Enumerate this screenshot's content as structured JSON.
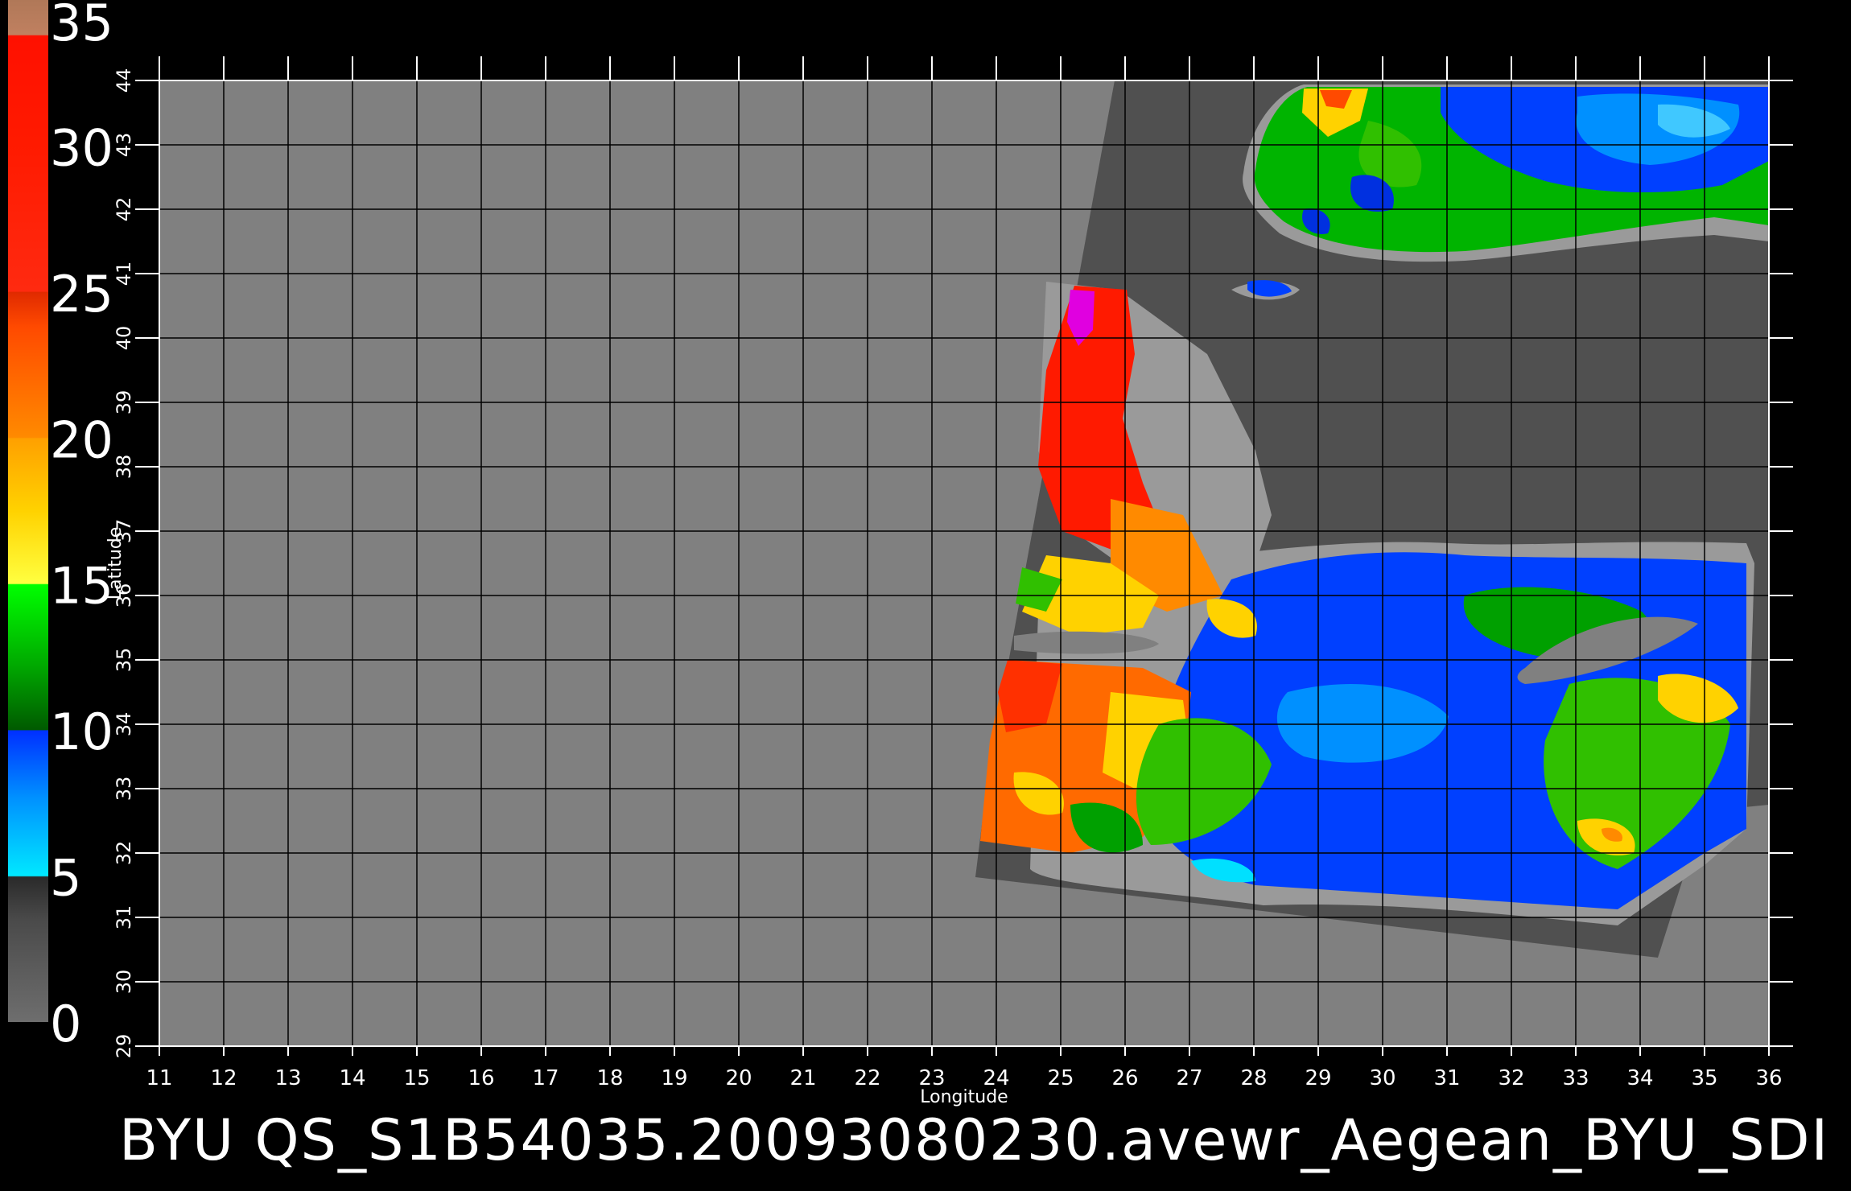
{
  "caption": "BYU QS_S1B54035.20093080230.avewr_Aegean_BYU_SDI",
  "axes": {
    "xlabel": "Longitude",
    "ylabel": "Latitude",
    "lon_range": [
      11,
      36
    ],
    "lat_range": [
      29,
      44
    ],
    "lon_ticks": [
      "11",
      "12",
      "13",
      "14",
      "15",
      "16",
      "17",
      "18",
      "19",
      "20",
      "21",
      "22",
      "23",
      "24",
      "25",
      "26",
      "27",
      "28",
      "29",
      "30",
      "31",
      "32",
      "33",
      "34",
      "35",
      "36"
    ],
    "lat_ticks": [
      "29",
      "30",
      "31",
      "32",
      "33",
      "34",
      "35",
      "36",
      "37",
      "38",
      "39",
      "40",
      "41",
      "42",
      "43",
      "44"
    ],
    "grid": true
  },
  "colorbar": {
    "labels": [
      "0",
      "5",
      "10",
      "15",
      "20",
      "25",
      "30",
      "35"
    ],
    "range": [
      0,
      35
    ]
  },
  "colors": {
    "background": "#000000",
    "no_data": "#808080",
    "swath_land": "#505050",
    "coast": "#9a9a9a",
    "grid": "#000000"
  }
}
